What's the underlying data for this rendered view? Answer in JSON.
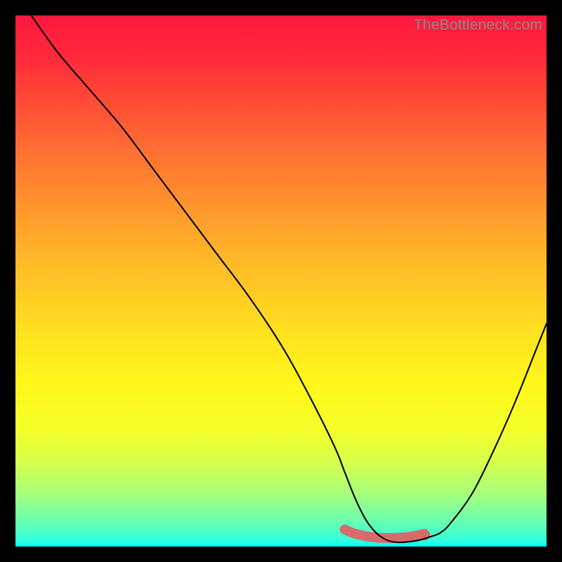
{
  "watermark": "TheBottleneck.com",
  "chart_data": {
    "type": "line",
    "title": "",
    "xlabel": "",
    "ylabel": "",
    "xlim": [
      0,
      100
    ],
    "ylim": [
      0,
      100
    ],
    "grid": false,
    "series": [
      {
        "name": "bottleneck-curve",
        "color": "#000000",
        "x": [
          3,
          8,
          14,
          20,
          26,
          32,
          38,
          44,
          50,
          55,
          60,
          62,
          64,
          66,
          68,
          70,
          72,
          74,
          76,
          78,
          80,
          82,
          86,
          90,
          94,
          98,
          100
        ],
        "y": [
          100,
          93,
          86,
          79,
          71,
          63,
          55,
          47,
          38,
          29,
          19,
          14,
          9,
          5,
          2.5,
          1.2,
          0.8,
          0.9,
          1.2,
          1.8,
          2.6,
          4.5,
          10,
          18,
          27,
          37,
          42
        ]
      },
      {
        "name": "optimal-range-accent",
        "color": "#d76b6b",
        "x": [
          62,
          64,
          67,
          70,
          74,
          77
        ],
        "y": [
          3.2,
          2.4,
          1.8,
          1.6,
          1.8,
          2.4
        ]
      }
    ],
    "accent_end_point": {
      "x": 77,
      "y": 2.2
    },
    "background_gradient": {
      "top": "#ff173e",
      "mid": "#ffe21f",
      "bottom": "#00ffff"
    }
  }
}
